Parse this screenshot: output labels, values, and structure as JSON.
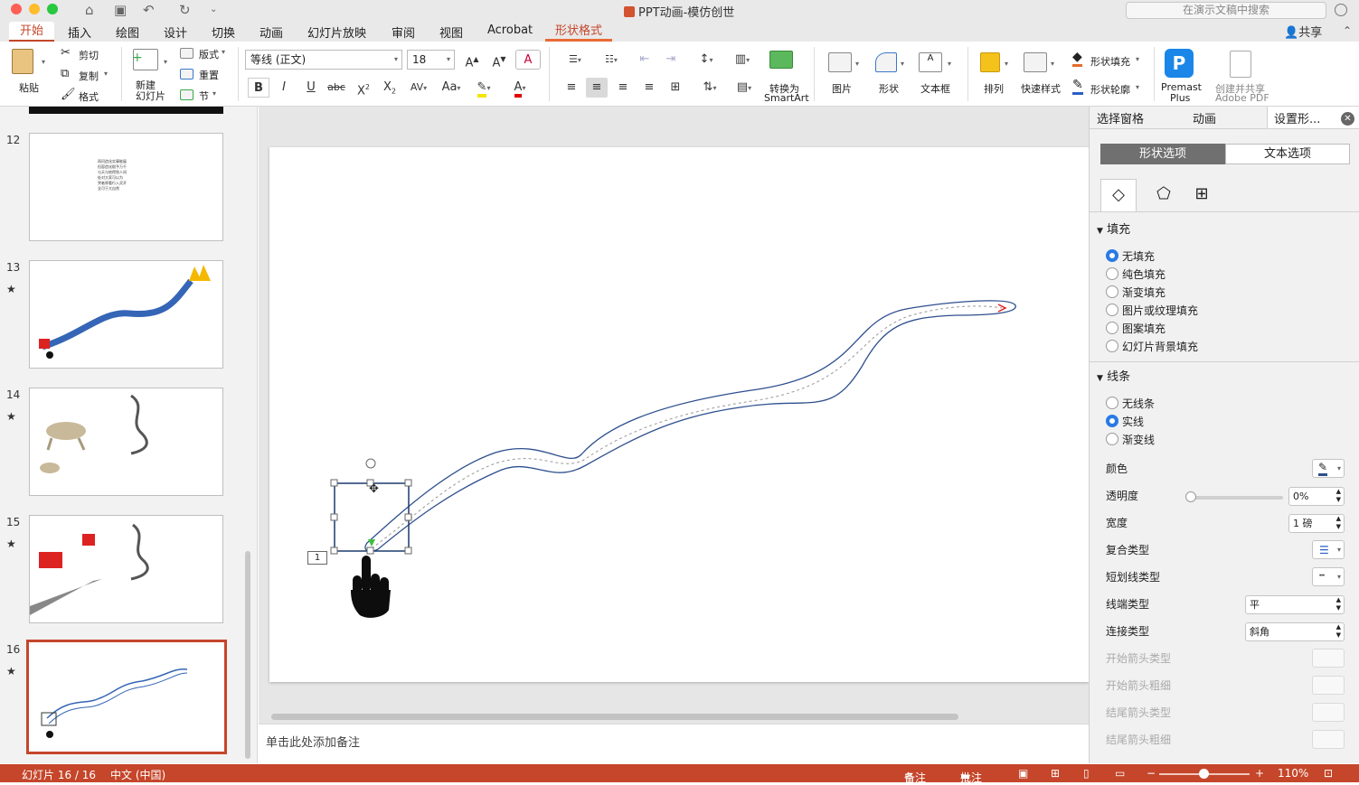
{
  "window": {
    "title": "PPT动画-模仿创世",
    "search_placeholder": "在演示文稿中搜索",
    "share_label": "共享"
  },
  "tabs": [
    "开始",
    "插入",
    "绘图",
    "设计",
    "切换",
    "动画",
    "幻灯片放映",
    "审阅",
    "视图",
    "Acrobat",
    "形状格式"
  ],
  "ribbon": {
    "paste": "粘贴",
    "cut": "剪切",
    "copy": "复制",
    "format": "格式",
    "new_slide": "新建\n幻灯片",
    "layout": "版式",
    "reset": "重置",
    "section": "节",
    "font_name": "等线 (正文)",
    "font_size": "18",
    "convert_smartart_1": "转换为",
    "convert_smartart_2": "SmartArt",
    "picture": "图片",
    "shapes": "形状",
    "textbox": "文本框",
    "arrange": "排列",
    "quick_styles": "快速样式",
    "shape_fill": "形状填充",
    "shape_outline": "形状轮廓",
    "premast_1": "Premast",
    "premast_2": "Plus",
    "create_share_1": "创建并共享",
    "create_share_2": "Adobe PDF",
    "colors": {
      "accent": "#c5462a",
      "highlight": "#f5e600",
      "font_color": "#e00000"
    }
  },
  "slides": [
    {
      "num": "12",
      "star": false
    },
    {
      "num": "13",
      "star": true
    },
    {
      "num": "14",
      "star": true
    },
    {
      "num": "15",
      "star": true
    },
    {
      "num": "16",
      "star": true
    }
  ],
  "slide12_text": "再问造化实事能展\n但容造化赋予万千\n与天与地得到人间\n处对大家可以为\n哭者原看行入灵开\n全可于大自然",
  "canvas": {
    "motion_path_number": "1",
    "notes_placeholder": "单击此处添加备注"
  },
  "panel": {
    "tabs": [
      "选择窗格",
      "动画",
      "设置形..."
    ],
    "seg_shape": "形状选项",
    "seg_text": "文本选项",
    "fill_header": "填充",
    "fill_options": [
      {
        "label": "无填充",
        "checked": true
      },
      {
        "label": "纯色填充",
        "checked": false
      },
      {
        "label": "渐变填充",
        "checked": false
      },
      {
        "label": "图片或纹理填充",
        "checked": false
      },
      {
        "label": "图案填充",
        "checked": false
      },
      {
        "label": "幻灯片背景填充",
        "checked": false
      }
    ],
    "line_header": "线条",
    "line_options": [
      {
        "label": "无线条",
        "checked": false
      },
      {
        "label": "实线",
        "checked": true
      },
      {
        "label": "渐变线",
        "checked": false
      }
    ],
    "color_label": "颜色",
    "transparency_label": "透明度",
    "transparency_value": "0%",
    "width_label": "宽度",
    "width_value": "1 磅",
    "compound_label": "复合类型",
    "dash_label": "短划线类型",
    "cap_label": "线端类型",
    "cap_value": "平",
    "join_label": "连接类型",
    "join_value": "斜角",
    "start_arrow_type": "开始箭头类型",
    "start_arrow_size": "开始箭头粗细",
    "end_arrow_type": "结尾箭头类型",
    "end_arrow_size": "结尾箭头粗细"
  },
  "status": {
    "slide_counter": "幻灯片 16 / 16",
    "language": "中文 (中国)",
    "notes": "备注",
    "comments": "批注",
    "zoom": "110%"
  }
}
